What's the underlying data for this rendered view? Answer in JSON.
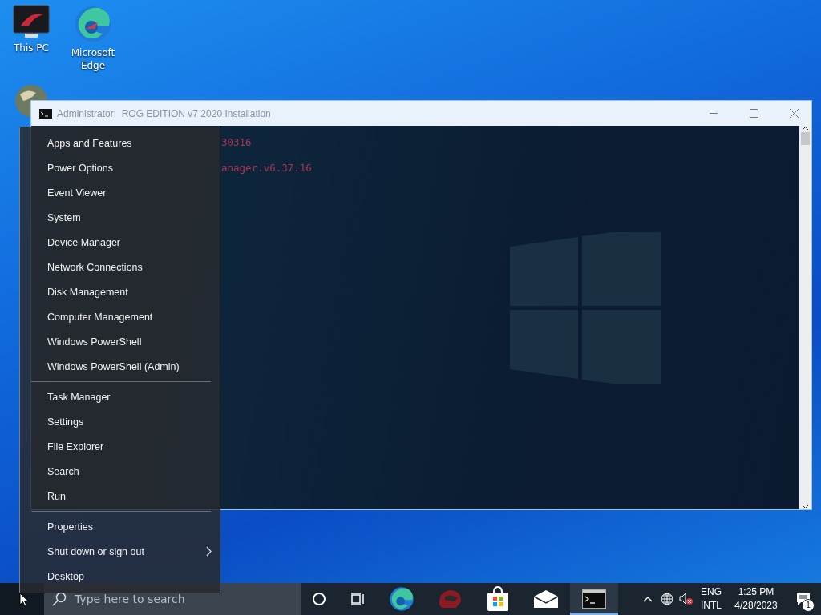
{
  "desktop": {
    "icons": [
      {
        "kind": "pc",
        "label": "This PC"
      },
      {
        "kind": "edge",
        "label": "Microsoft Edge"
      },
      {
        "kind": "network"
      }
    ]
  },
  "console_window": {
    "title": "Administrator:  ROG EDITION v7 2020 Installation",
    "lines": [
      "30316",
      "anager.v6.37.16"
    ]
  },
  "context_menu": {
    "sections": [
      {
        "items": [
          {
            "label": "Apps and Features",
            "submenu": false
          },
          {
            "label": "Power Options",
            "submenu": false
          },
          {
            "label": "Event Viewer",
            "submenu": false
          },
          {
            "label": "System",
            "submenu": false
          },
          {
            "label": "Device Manager",
            "submenu": false
          },
          {
            "label": "Network Connections",
            "submenu": false
          },
          {
            "label": "Disk Management",
            "submenu": false
          },
          {
            "label": "Computer Management",
            "submenu": false
          },
          {
            "label": "Windows PowerShell",
            "submenu": false
          },
          {
            "label": "Windows PowerShell (Admin)",
            "submenu": false
          }
        ]
      },
      {
        "items": [
          {
            "label": "Task Manager",
            "submenu": false
          },
          {
            "label": "Settings",
            "submenu": false
          },
          {
            "label": "File Explorer",
            "submenu": false
          },
          {
            "label": "Search",
            "submenu": false
          },
          {
            "label": "Run",
            "submenu": false
          }
        ]
      },
      {
        "items": [
          {
            "label": "Properties",
            "submenu": false
          },
          {
            "label": "Shut down or sign out",
            "submenu": true
          },
          {
            "label": "Desktop",
            "submenu": false
          }
        ]
      }
    ]
  },
  "taskbar": {
    "search": {
      "placeholder": "Type here to search"
    },
    "apps": [
      {
        "kind": "cortana",
        "active": false
      },
      {
        "kind": "taskview",
        "active": false
      },
      {
        "kind": "edge",
        "active": false
      },
      {
        "kind": "game",
        "active": false
      },
      {
        "kind": "store",
        "active": false
      },
      {
        "kind": "mail",
        "active": false
      },
      {
        "kind": "console",
        "active": true
      }
    ],
    "tray": {
      "language": "ENG",
      "layout": "INTL",
      "time": "1:25 PM",
      "date": "4/28/2023",
      "notifications": "1"
    }
  }
}
